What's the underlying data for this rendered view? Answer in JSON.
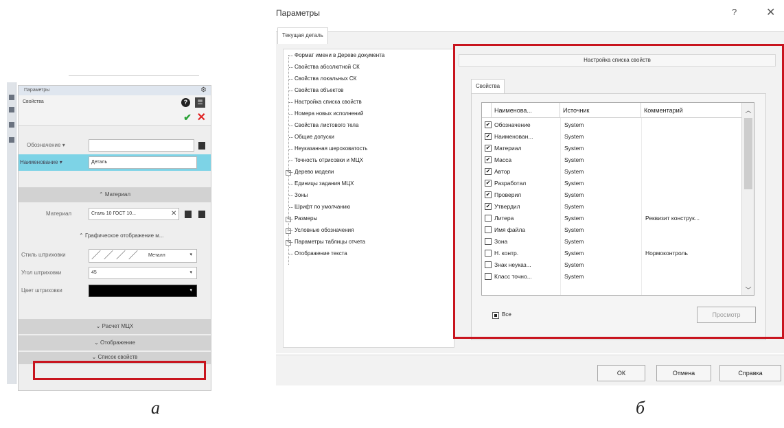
{
  "left_panel": {
    "title": "Параметры",
    "section_label": "Свойства",
    "designation_label": "Обозначение",
    "name_label": "Наименование",
    "name_value": "Деталь",
    "material_header": "Материал",
    "material_label": "Материал",
    "material_value": "Сталь 10 ГОСТ 10...",
    "graphics_header": "Графическое отображение м...",
    "hatch_style_label": "Стиль штриховки",
    "hatch_style_value": "Металл",
    "hatch_angle_label": "Угол штриховки",
    "hatch_angle_value": "45",
    "hatch_color_label": "Цвет штриховки",
    "mcx_header": "Расчет МЦХ",
    "display_header": "Отображение",
    "props_list_header": "Список свойств",
    "caption": "а"
  },
  "dialog": {
    "title": "Параметры",
    "help_glyph": "?",
    "close_glyph": "✕",
    "main_tab": "Текущая деталь",
    "tree": [
      {
        "label": "Формат имени в Дереве документа",
        "expandable": false
      },
      {
        "label": "Свойства абсолютной СК",
        "expandable": false
      },
      {
        "label": "Свойства локальных СК",
        "expandable": false
      },
      {
        "label": "Свойства объектов",
        "expandable": false
      },
      {
        "label": "Настройка списка свойств",
        "expandable": false
      },
      {
        "label": "Номера новых исполнений",
        "expandable": false
      },
      {
        "label": "Свойства листового тела",
        "expandable": false
      },
      {
        "label": "Общие допуски",
        "expandable": false
      },
      {
        "label": "Неуказанная шероховатость",
        "expandable": false
      },
      {
        "label": "Точность отрисовки и МЦХ",
        "expandable": false
      },
      {
        "label": "Дерево модели",
        "expandable": true
      },
      {
        "label": "Единицы задания МЦХ",
        "expandable": false
      },
      {
        "label": "Зоны",
        "expandable": false
      },
      {
        "label": "Шрифт по умолчанию",
        "expandable": false
      },
      {
        "label": "Размеры",
        "expandable": true
      },
      {
        "label": "Условные обозначения",
        "expandable": true
      },
      {
        "label": "Параметры таблицы отчета",
        "expandable": true
      },
      {
        "label": "Отображение текста",
        "expandable": false
      }
    ],
    "section_title": "Настройка списка свойств",
    "sub_tab": "Свойства",
    "columns": [
      "Наименова...",
      "Источник",
      "Комментарий"
    ],
    "rows": [
      {
        "checked": "✔",
        "name": "Обозначение",
        "source": "System",
        "comment": ""
      },
      {
        "checked": "✔",
        "name": "Наименован...",
        "source": "System",
        "comment": ""
      },
      {
        "checked": "✔",
        "name": "Материал",
        "source": "System",
        "comment": ""
      },
      {
        "checked": "✔",
        "name": "Масса",
        "source": "System",
        "comment": ""
      },
      {
        "checked": "✔",
        "name": "Автор",
        "source": "System",
        "comment": ""
      },
      {
        "checked": "✔",
        "name": "Разработал",
        "source": "System",
        "comment": ""
      },
      {
        "checked": "✔",
        "name": "Проверил",
        "source": "System",
        "comment": ""
      },
      {
        "checked": "✔",
        "name": "Утвердил",
        "source": "System",
        "comment": ""
      },
      {
        "checked": "",
        "name": "Литера",
        "source": "System",
        "comment": "Реквизит конструк..."
      },
      {
        "checked": "",
        "name": "Имя файла",
        "source": "System",
        "comment": ""
      },
      {
        "checked": "",
        "name": "Зона",
        "source": "System",
        "comment": ""
      },
      {
        "checked": "",
        "name": "Н. контр.",
        "source": "System",
        "comment": "Нормоконтроль"
      },
      {
        "checked": "",
        "name": "Знак неуказ...",
        "source": "System",
        "comment": ""
      },
      {
        "checked": "",
        "name": "Класс точно...",
        "source": "System",
        "comment": ""
      }
    ],
    "all_label": "Все",
    "preview_button": "Просмотр",
    "ok_button": "ОК",
    "cancel_button": "Отмена",
    "help_button": "Справка",
    "caption": "б"
  },
  "colors": {
    "highlight": "#c8141e",
    "selected_field": "#7dd3e6",
    "ok_check": "#2aa236",
    "cancel_cross": "#e02424"
  }
}
